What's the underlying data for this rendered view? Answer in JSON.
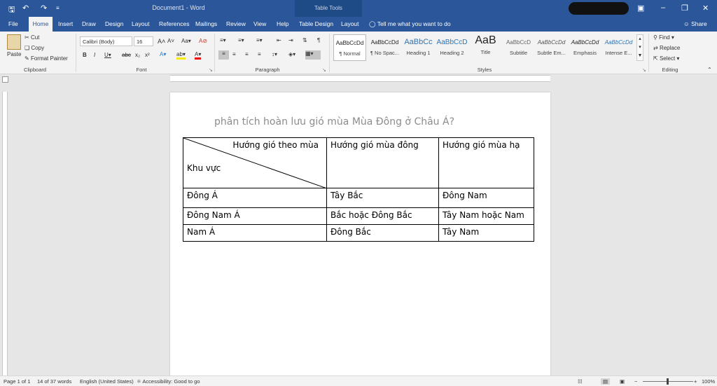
{
  "titlebar": {
    "doc_title": "Document1 - Word",
    "table_tools": "Table Tools"
  },
  "tabs": [
    "File",
    "Home",
    "Insert",
    "Draw",
    "Design",
    "Layout",
    "References",
    "Mailings",
    "Review",
    "View",
    "Help",
    "Table Design",
    "Layout"
  ],
  "tell_me": "Tell me what you want to do",
  "share": "Share",
  "clipboard": {
    "paste": "Paste",
    "cut": "Cut",
    "copy": "Copy",
    "format_painter": "Format Painter",
    "label": "Clipboard"
  },
  "font": {
    "family": "Calibri (Body)",
    "size": "16",
    "label": "Font"
  },
  "paragraph": {
    "label": "Paragraph"
  },
  "styles": {
    "label": "Styles",
    "items": [
      {
        "preview": "AaBbCcDd",
        "name": "¶ Normal"
      },
      {
        "preview": "AaBbCcDd",
        "name": "¶ No Spac..."
      },
      {
        "preview": "AaBbCc",
        "name": "Heading 1"
      },
      {
        "preview": "AaBbCcD",
        "name": "Heading 2"
      },
      {
        "preview": "AaB",
        "name": "Title"
      },
      {
        "preview": "AaBbCcD",
        "name": "Subtitle"
      },
      {
        "preview": "AaBbCcDd",
        "name": "Subtle Em..."
      },
      {
        "preview": "AaBbCcDd",
        "name": "Emphasis"
      },
      {
        "preview": "AaBbCcDd",
        "name": "Intense E..."
      }
    ]
  },
  "editing": {
    "find": "Find",
    "replace": "Replace",
    "select": "Select",
    "label": "Editing"
  },
  "document": {
    "heading": "phân tích hoàn lưu gió mùa Mùa Đông ở Châu Á?",
    "table": {
      "diag_top": "Hướng gió theo mùa",
      "diag_bottom": "Khu vực",
      "col2": "Hướng gió mùa đông",
      "col3": "Hướng gió mùa hạ",
      "rows": [
        [
          "Đông Á",
          "Tây Bắc",
          "Đông Nam"
        ],
        [
          "Đông Nam Á",
          "Bắc hoặc Đông Bắc",
          "Tây Nam hoặc Nam"
        ],
        [
          "Nam Á",
          "Đông Bắc",
          "Tây Nam"
        ]
      ]
    }
  },
  "status": {
    "page": "Page 1 of 1",
    "words": "14 of 37 words",
    "language": "English (United States)",
    "accessibility": "Accessibility: Good to go",
    "zoom": "100%"
  },
  "colors": {
    "brand": "#2b579a",
    "ribbon": "#f3f3f3"
  }
}
